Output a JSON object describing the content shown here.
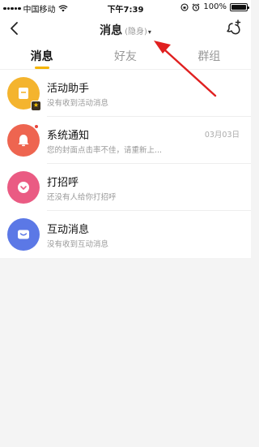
{
  "status_bar": {
    "carrier": "中国移动",
    "time": "下午7:39",
    "battery": "100%",
    "battery_level": 1.0
  },
  "nav": {
    "title": "消息",
    "visibility": "(隐身)",
    "caret": "▾"
  },
  "tabs": [
    {
      "label": "消息",
      "active": true
    },
    {
      "label": "好友",
      "active": false
    },
    {
      "label": "群组",
      "active": false
    }
  ],
  "messages": [
    {
      "title": "活动助手",
      "subtitle": "没有收到活动消息",
      "time": "",
      "icon": "activity-icon",
      "color": "#f4b42e"
    },
    {
      "title": "系统通知",
      "subtitle": "您的封面点击率不佳，请重新上...",
      "time": "03月03日",
      "icon": "bell-icon",
      "color": "#ee6550",
      "unread": true
    },
    {
      "title": "打招呼",
      "subtitle": "还没有人给你打招呼",
      "time": "",
      "icon": "heart-icon",
      "color": "#ea5b83"
    },
    {
      "title": "互动消息",
      "subtitle": "没有收到互动消息",
      "time": "",
      "icon": "envelope-icon",
      "color": "#5b78e6"
    }
  ],
  "colors": {
    "accent": "#f5b400",
    "arrow": "#e02020"
  }
}
